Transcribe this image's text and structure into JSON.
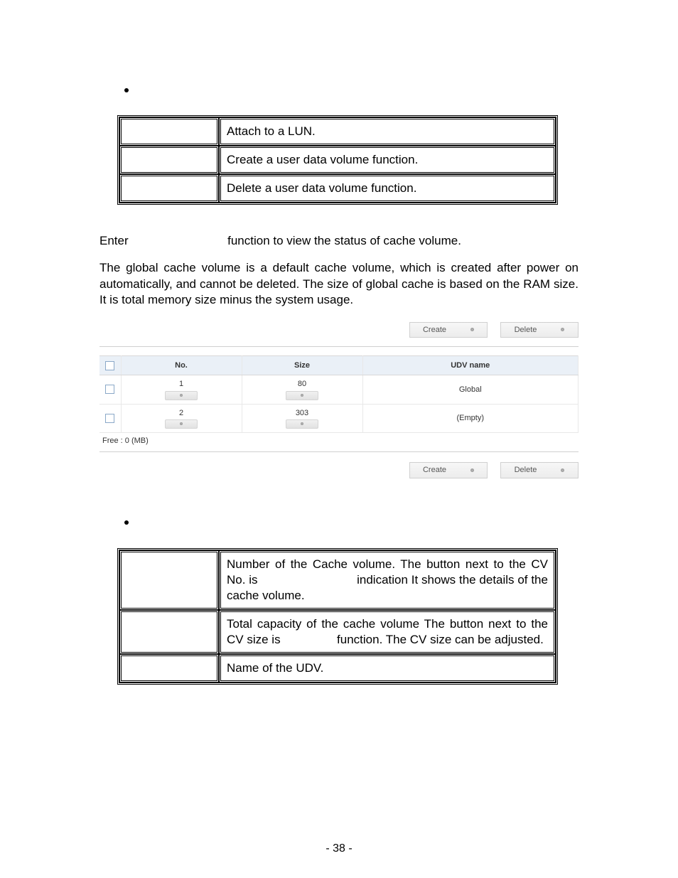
{
  "table1": {
    "rows": [
      {
        "c2": "Attach to a LUN."
      },
      {
        "c2": "Create a user data volume function."
      },
      {
        "c2": "Delete a user data volume function."
      }
    ]
  },
  "text": {
    "enter_prefix": "Enter",
    "enter_suffix": "function to view the status of cache volume.",
    "global_desc": "The global cache volume is a default cache volume, which is created after power on automatically, and cannot be deleted. The size of global cache is based on the RAM size. It is total memory size minus the system usage."
  },
  "subfig": {
    "buttons": {
      "create": "Create",
      "delete": "Delete"
    },
    "headers": {
      "no": "No.",
      "size": "Size",
      "udv": "UDV name"
    },
    "rows": [
      {
        "no": "1",
        "size": "80",
        "udv": "Global"
      },
      {
        "no": "2",
        "size": "303",
        "udv": "(Empty)"
      }
    ],
    "free": "Free : 0 (MB)"
  },
  "table2": {
    "rows": [
      {
        "c2a": "Number of the Cache volume.  The button next to the CV No. is",
        "c2b": "indication  It shows the",
        "c2c": "details of the cache volume."
      },
      {
        "c2a": "Total capacity of the cache volume The button next to the CV size is",
        "c2b": "function. The CV size can be",
        "c2c": "adjusted."
      },
      {
        "c2": "Name of the UDV."
      }
    ]
  },
  "page_number": "- 38 -"
}
